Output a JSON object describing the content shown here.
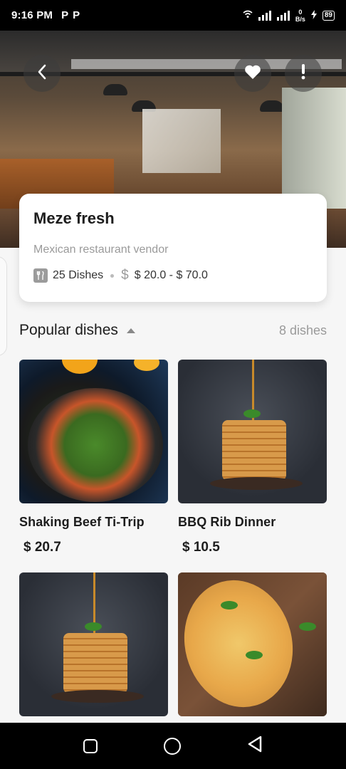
{
  "status_bar": {
    "time": "9:16 PM",
    "app_icons": [
      "P",
      "P"
    ],
    "net_speed_value": "0",
    "net_speed_unit": "B/s",
    "battery": "89"
  },
  "hero": {
    "back_icon": "chevron-left-icon",
    "favorite_icon": "heart-icon",
    "report_icon": "exclamation-icon"
  },
  "restaurant": {
    "name": "Meze fresh",
    "subtitle": "Mexican restaurant vendor",
    "dish_count": "25 Dishes",
    "price_range": "$ 20.0 - $ 70.0"
  },
  "popular": {
    "title": "Popular dishes",
    "count": "8 dishes",
    "dishes": [
      {
        "name": "Shaking Beef Ti-Trip",
        "price": "$ 20.7"
      },
      {
        "name": "BBQ Rib Dinner",
        "price": "$ 10.5"
      },
      {
        "name": "",
        "price": ""
      },
      {
        "name": "",
        "price": ""
      }
    ]
  },
  "nav": {
    "recents": "square-icon",
    "home": "circle-icon",
    "back": "triangle-back-icon"
  }
}
